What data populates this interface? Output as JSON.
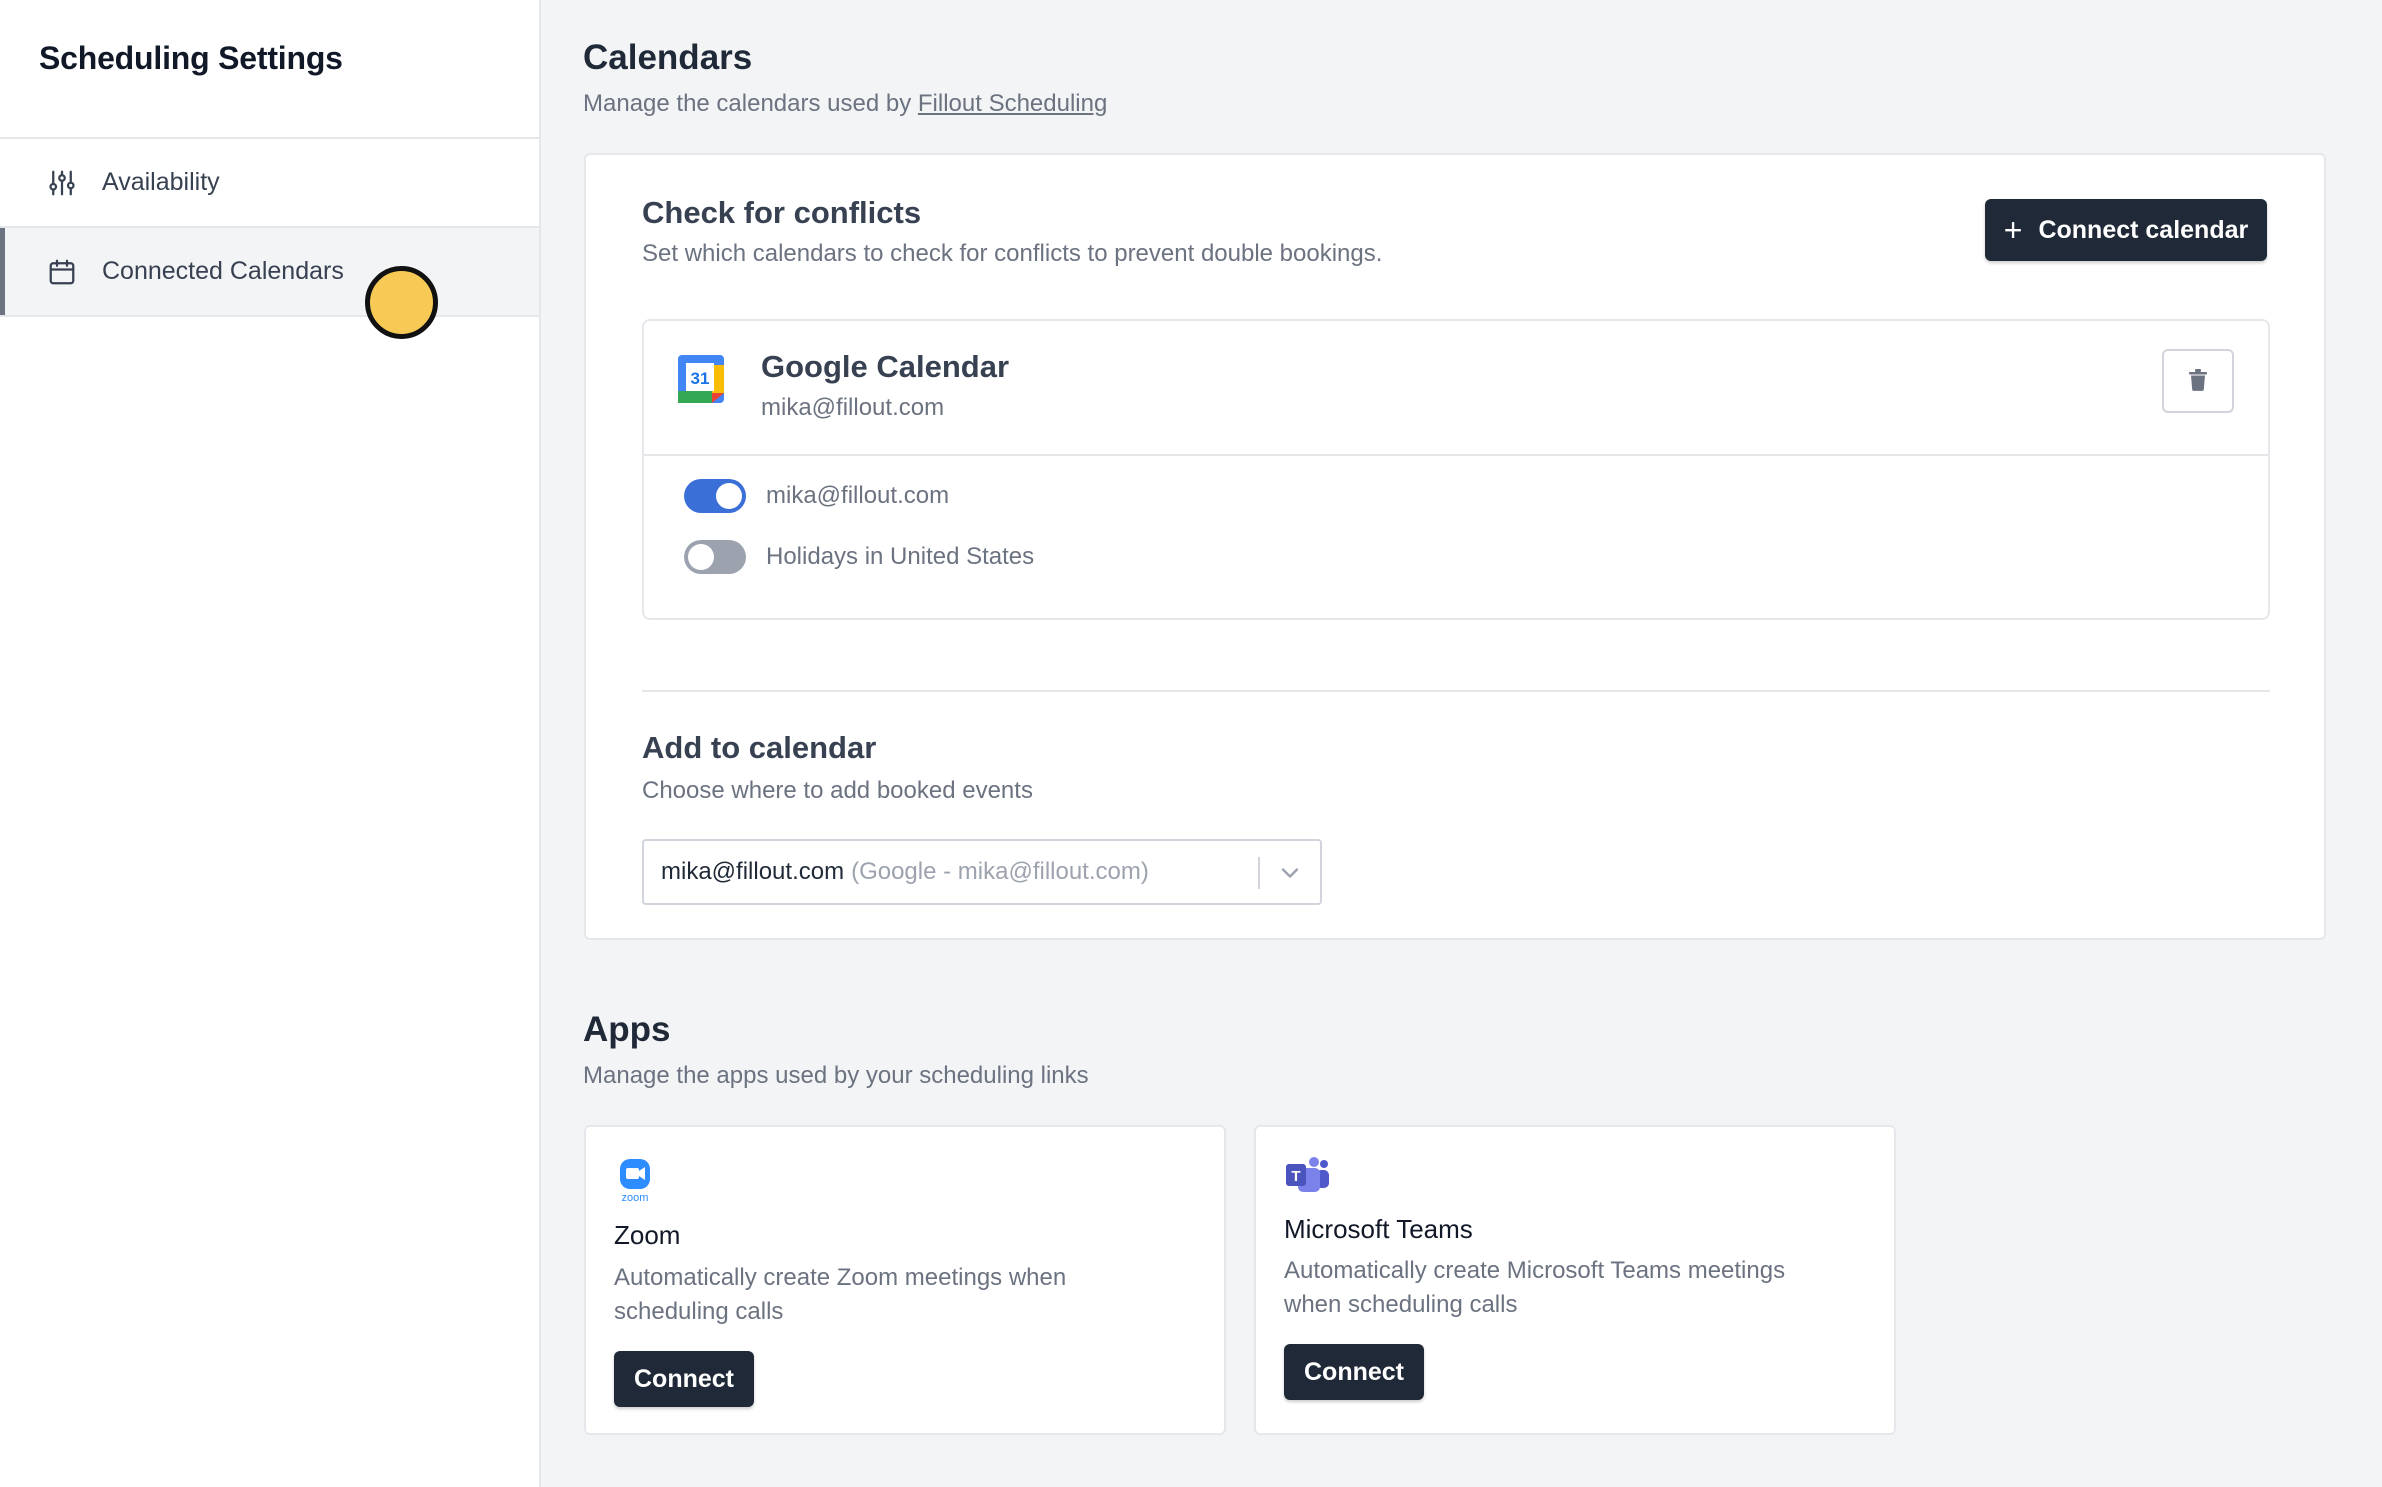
{
  "sidebar": {
    "title": "Scheduling Settings",
    "items": [
      {
        "label": "Availability",
        "icon": "sliders-icon",
        "active": false
      },
      {
        "label": "Connected Calendars",
        "icon": "calendar-icon",
        "active": true
      }
    ]
  },
  "calendars": {
    "title": "Calendars",
    "subtitle_prefix": "Manage the calendars used by ",
    "subtitle_link": "Fillout Scheduling",
    "conflicts": {
      "title": "Check for conflicts",
      "subtitle": "Set which calendars to check for conflicts to prevent double bookings.",
      "connect_button": "Connect calendar",
      "account": {
        "name": "Google Calendar",
        "email": "mika@fillout.com",
        "logo_day": "31",
        "calendars": [
          {
            "label": "mika@fillout.com",
            "enabled": true
          },
          {
            "label": "Holidays in United States",
            "enabled": false
          }
        ]
      }
    },
    "add_to": {
      "title": "Add to calendar",
      "subtitle": "Choose where to add booked events",
      "selected_value": "mika@fillout.com",
      "selected_detail": "(Google - mika@fillout.com)"
    }
  },
  "apps": {
    "title": "Apps",
    "subtitle": "Manage the apps used by your scheduling links",
    "items": [
      {
        "name": "Zoom",
        "logo_text": "zoom",
        "description": "Automatically create Zoom meetings when scheduling calls",
        "button": "Connect"
      },
      {
        "name": "Microsoft Teams",
        "logo_text": "T",
        "description": "Automatically create Microsoft Teams meetings when scheduling calls",
        "button": "Connect"
      }
    ]
  },
  "colors": {
    "primary_dark": "#1f2937",
    "toggle_on": "#3b6fd8",
    "toggle_off": "#9ca3af",
    "cursor_marker": "#f7ca55"
  }
}
